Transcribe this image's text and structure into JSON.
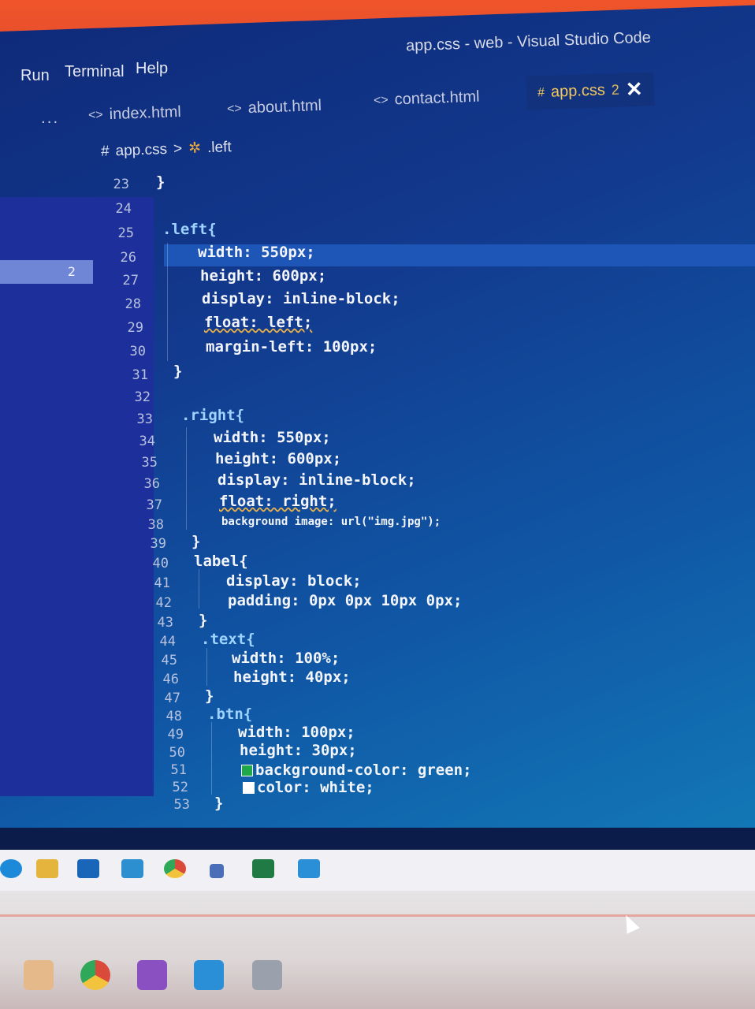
{
  "window": {
    "title": "app.css - web - Visual Studio Code"
  },
  "menu": {
    "items": [
      "Run",
      "Terminal",
      "Help"
    ]
  },
  "tabs": [
    {
      "label": "index.html",
      "icon": "html-icon"
    },
    {
      "label": "about.html",
      "icon": "html-icon"
    },
    {
      "label": "contact.html",
      "icon": "html-icon"
    },
    {
      "label": "app.css",
      "icon": "css-hash-icon",
      "problems": "2",
      "active": true
    }
  ],
  "tab_overflow": "...",
  "breadcrumb": {
    "file": "app.css",
    "separator": ">",
    "symbol": ".left"
  },
  "sidebar": {
    "badge": "2"
  },
  "code": [
    {
      "n": "23",
      "t": "}"
    },
    {
      "n": "24",
      "t": ""
    },
    {
      "n": "25",
      "t": ".left{"
    },
    {
      "n": "26",
      "t": "width: 550px;"
    },
    {
      "n": "27",
      "t": "height: 600px;"
    },
    {
      "n": "28",
      "t": "display: inline-block;"
    },
    {
      "n": "29",
      "t": "float: left;"
    },
    {
      "n": "30",
      "t": "margin-left: 100px;"
    },
    {
      "n": "31",
      "t": "}"
    },
    {
      "n": "32",
      "t": ""
    },
    {
      "n": "33",
      "t": ".right{"
    },
    {
      "n": "34",
      "t": "width: 550px;"
    },
    {
      "n": "35",
      "t": "height: 600px;"
    },
    {
      "n": "36",
      "t": "display: inline-block;"
    },
    {
      "n": "37",
      "t": "float: right;"
    },
    {
      "n": "38",
      "t": "background image: url(\"img.jpg\");"
    },
    {
      "n": "39",
      "t": "}"
    },
    {
      "n": "40",
      "t": "label{"
    },
    {
      "n": "41",
      "t": "display: block;"
    },
    {
      "n": "42",
      "t": "padding: 0px 0px 10px 0px;"
    },
    {
      "n": "43",
      "t": "}"
    },
    {
      "n": "44",
      "t": ".text{"
    },
    {
      "n": "45",
      "t": "width: 100%;"
    },
    {
      "n": "46",
      "t": "height: 40px;"
    },
    {
      "n": "47",
      "t": "}"
    },
    {
      "n": "48",
      "t": ".btn{"
    },
    {
      "n": "49",
      "t": "width: 100px;"
    },
    {
      "n": "50",
      "t": "height: 30px;"
    },
    {
      "n": "51",
      "t": "background-color: green;"
    },
    {
      "n": "52",
      "t": "color: white;"
    },
    {
      "n": "53",
      "t": "}"
    }
  ],
  "colors": {
    "editor_bg": "#1058a6",
    "sidebar_bg": "#1c2f9a",
    "swatch_green": "#1ea84a",
    "swatch_white": "#ffffff",
    "squiggle": "#e5b04a"
  },
  "taskbar": {
    "icons": [
      "edge-icon",
      "file-explorer-icon",
      "store-icon",
      "mail-icon",
      "chrome-icon",
      "app-icon",
      "excel-icon",
      "vscode-icon"
    ],
    "lower_icons": [
      "folder-icon",
      "chrome-icon",
      "visual-studio-icon",
      "vscode-icon",
      "app-window-icon"
    ]
  }
}
